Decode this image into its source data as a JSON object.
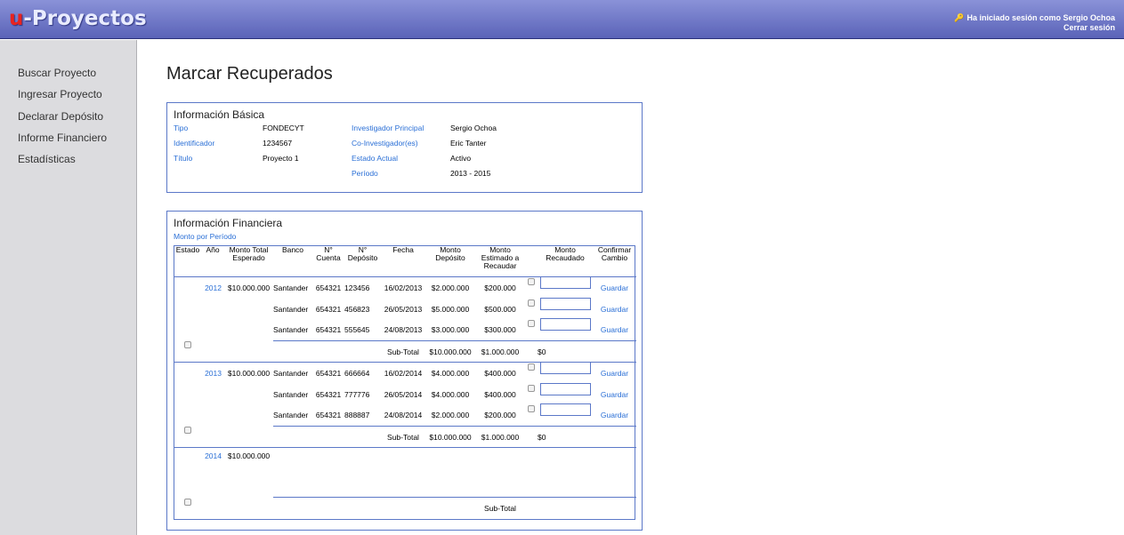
{
  "header": {
    "logo_prefix": "u",
    "logo_suffix": "-Proyectos",
    "login_text": "Ha iniciado sesión como Sergio Ochoa",
    "logout_label": "Cerrar sesión",
    "colors": {
      "header_top": "#8a92d8",
      "header_bottom": "#5a63b8",
      "logo_accent": "#e8231f",
      "link": "#2a6fd6"
    }
  },
  "sidebar": {
    "items": [
      {
        "label": "Buscar Proyecto"
      },
      {
        "label": "Ingresar Proyecto"
      },
      {
        "label": "Declarar Depósito"
      },
      {
        "label": "Informe Financiero"
      },
      {
        "label": "Estadísticas"
      }
    ]
  },
  "main": {
    "title": "Marcar Recuperados",
    "basic": {
      "title": "Información Básica",
      "tipo_label": "Tipo",
      "tipo_value": "FONDECYT",
      "id_label": "Identificador",
      "id_value": "1234567",
      "titulo_label": "Título",
      "titulo_value": "Proyecto 1",
      "inv_label": "Investigador Principal",
      "inv_value": "Sergio Ochoa",
      "coinv_label": "Co-Investigador(es)",
      "coinv_value": "Eric Tanter",
      "estado_label": "Estado Actual",
      "estado_value": "Activo",
      "periodo_label": "Período",
      "periodo_value": "2013 - 2015"
    },
    "financial": {
      "title": "Información Financiera",
      "monto_periodo_link": "Monto por Período",
      "headers": {
        "estado": "Estado",
        "anio": "Año",
        "monto_total": "Monto Total Esperado",
        "banco": "Banco",
        "cuenta": "N° Cuenta",
        "deposito": "N° Depósito",
        "fecha": "Fecha",
        "monto_dep": "Monto Depósito",
        "monto_est": "Monto Estimado a Recaudar",
        "monto_rec": "Monto Recaudado",
        "confirmar": "Confirmar Cambio"
      },
      "years": [
        {
          "year": "2012",
          "total": "$10.000.000",
          "rows": [
            {
              "banco": "Santander",
              "cuenta": "654321",
              "deposito": "123456",
              "fecha": "16/02/2013",
              "monto": "$2.000.000",
              "estimado": "$200.000",
              "guardar": "Guardar"
            },
            {
              "banco": "Santander",
              "cuenta": "654321",
              "deposito": "456823",
              "fecha": "26/05/2013",
              "monto": "$5.000.000",
              "estimado": "$500.000",
              "guardar": "Guardar"
            },
            {
              "banco": "Santander",
              "cuenta": "654321",
              "deposito": "555645",
              "fecha": "24/08/2013",
              "monto": "$3.000.000",
              "estimado": "$300.000",
              "guardar": "Guardar"
            }
          ],
          "subtotal_label": "Sub-Total",
          "sub_monto": "$10.000.000",
          "sub_estimado": "$1.000.000",
          "sub_recaudado": "$0"
        },
        {
          "year": "2013",
          "total": "$10.000.000",
          "rows": [
            {
              "banco": "Santander",
              "cuenta": "654321",
              "deposito": "666664",
              "fecha": "16/02/2014",
              "monto": "$4.000.000",
              "estimado": "$400.000",
              "guardar": "Guardar"
            },
            {
              "banco": "Santander",
              "cuenta": "654321",
              "deposito": "777776",
              "fecha": "26/05/2014",
              "monto": "$4.000.000",
              "estimado": "$400.000",
              "guardar": "Guardar"
            },
            {
              "banco": "Santander",
              "cuenta": "654321",
              "deposito": "888887",
              "fecha": "24/08/2014",
              "monto": "$2.000.000",
              "estimado": "$200.000",
              "guardar": "Guardar"
            }
          ],
          "subtotal_label": "Sub-Total",
          "sub_monto": "$10.000.000",
          "sub_estimado": "$1.000.000",
          "sub_recaudado": "$0"
        },
        {
          "year": "2014",
          "total": "$10.000.000",
          "rows": [],
          "subtotal_label": "Sub-Total"
        }
      ]
    }
  }
}
